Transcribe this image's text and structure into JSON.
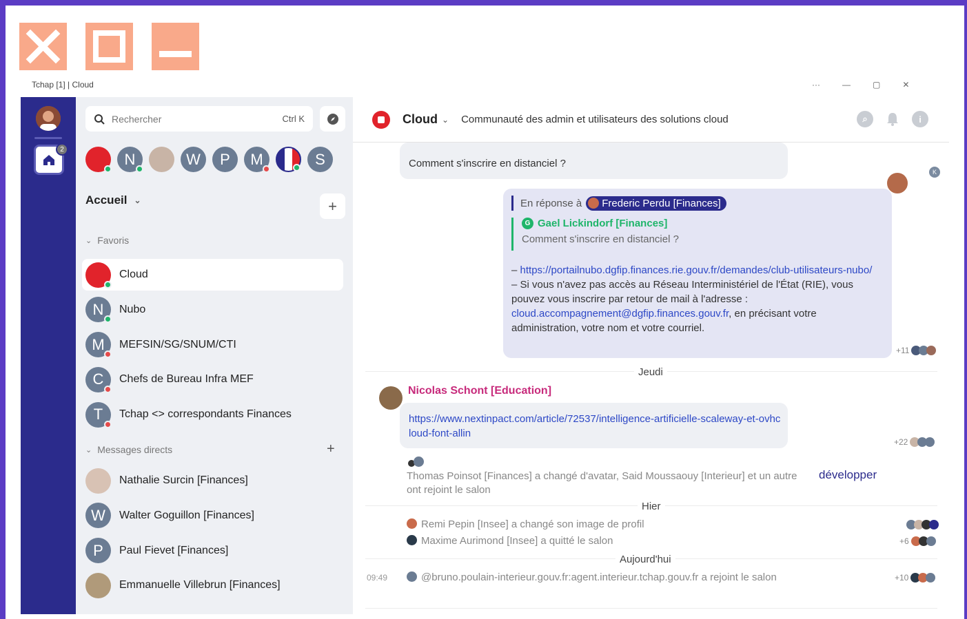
{
  "window": {
    "title": "Tchap [1] | Cloud",
    "close_label": "Close",
    "maximize_label": "Maximize",
    "minimize_label": "Minimize"
  },
  "spaces": {
    "home_badge": "2"
  },
  "search": {
    "placeholder": "Rechercher",
    "shortcut": "Ctrl K"
  },
  "top_avatars": [
    {
      "letter": "",
      "color": "#e1232b",
      "status": "online"
    },
    {
      "letter": "N",
      "color": "#6b7c93",
      "status": "online"
    },
    {
      "letter": "",
      "color": "#c8b4a6",
      "status": "none"
    },
    {
      "letter": "W",
      "color": "#6b7c93",
      "status": "none"
    },
    {
      "letter": "P",
      "color": "#6b7c93",
      "status": "none"
    },
    {
      "letter": "M",
      "color": "#6b7c93",
      "status": "busy"
    },
    {
      "letter": "",
      "color": "#ffffff",
      "status": "online"
    },
    {
      "letter": "S",
      "color": "#6b7c93",
      "status": "none"
    }
  ],
  "home": {
    "title": "Accueil"
  },
  "favorites": {
    "label": "Favoris",
    "rooms": [
      {
        "name": "Cloud",
        "letter": "",
        "color": "#e1232b",
        "status": "online",
        "active": true
      },
      {
        "name": "Nubo",
        "letter": "N",
        "color": "#6b7c93",
        "status": "online"
      },
      {
        "name": "MEFSIN/SG/SNUM/CTI",
        "letter": "M",
        "color": "#6b7c93",
        "status": "busy"
      },
      {
        "name": "Chefs de Bureau Infra MEF",
        "letter": "C",
        "color": "#6b7c93",
        "status": "busy"
      },
      {
        "name": "Tchap <> correspondants Finances",
        "letter": "T",
        "color": "#6b7c93",
        "status": "busy"
      }
    ]
  },
  "direct_messages": {
    "label": "Messages directs",
    "rooms": [
      {
        "name": "Nathalie Surcin [Finances]",
        "letter": "",
        "color": "#d8c2b4"
      },
      {
        "name": "Walter Goguillon [Finances]",
        "letter": "W",
        "color": "#6b7c93"
      },
      {
        "name": "Paul Fievet [Finances]",
        "letter": "P",
        "color": "#6b7c93"
      },
      {
        "name": "Emmanuelle Villebrun [Finances]",
        "letter": "",
        "color": "#b09a7a"
      }
    ]
  },
  "room": {
    "name": "Cloud",
    "topic": "Communauté des admin et utilisateurs des solutions cloud"
  },
  "timeline": {
    "question": "Comment s'inscrire en distanciel ?",
    "reply": {
      "in_reply_to": "En réponse à",
      "replied_user": "Frederic Perdu [Finances]",
      "quote_user": "Gael Lickindorf [Finances]",
      "quote_text": "Comment s'inscrire en distanciel ?",
      "line1_prefix": "– ",
      "link1": "https://portailnubo.dgfip.finances.rie.gouv.fr/demandes/club-utilisateurs-nubo/",
      "line2": "– Si vous n'avez pas accès au Réseau Interministériel de l'État (RIE), vous pouvez vous inscrire par retour de mail à l'adresse :",
      "email": "cloud.accompagnement@dgfip.finances.gouv.fr",
      "line3": ", en précisant votre administration, votre nom et votre courriel.",
      "receipt": "+11"
    },
    "day1": "Jeudi",
    "sender": "Nicolas Schont [Education]",
    "message_link": "https://www.nextinpact.com/article/72537/intelligence-artificielle-scaleway-et-ovhcloud-font-allin",
    "receipt2": "+22",
    "membership_summary": "Thomas Poinsot [Finances] a changé d'avatar, Said Moussaouy [Interieur] et un autre ont rejoint le salon",
    "expand": "développer",
    "day2": "Hier",
    "event1": "Remi Pepin [Insee] a changé son image de profil",
    "event2": "Maxime Aurimond [Insee] a quitté le salon",
    "receipt3": "+6",
    "day3": "Aujourd'hui",
    "time": "09:49",
    "event3": "@bruno.poulain-interieur.gouv.fr:agent.interieur.tchap.gouv.fr a rejoint le salon",
    "receipt4": "+10"
  }
}
